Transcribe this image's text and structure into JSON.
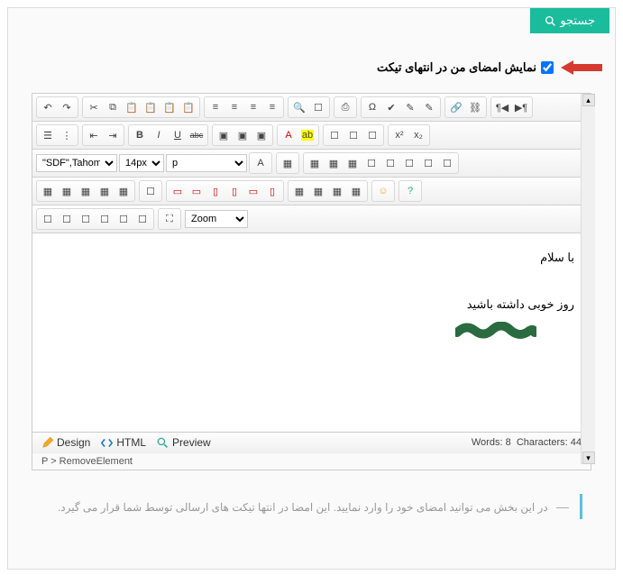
{
  "search": {
    "label": "جستجو"
  },
  "checkbox": {
    "label": "نمایش امضای من در انتهای تیکت",
    "checked": true
  },
  "toolbar": {
    "font_family": "\"SDF\",Tahom...",
    "font_size": "14px",
    "paragraph": "p",
    "zoom": "Zoom"
  },
  "content": {
    "line1": "با سلام",
    "line2": "روز خوبی داشته باشید"
  },
  "tabs": {
    "design": "Design",
    "html": "HTML",
    "preview": "Preview"
  },
  "status": {
    "words_label": "Words:",
    "words_val": "8",
    "chars_label": "Characters:",
    "chars_val": "44"
  },
  "path": "P > RemoveElement",
  "hint": "در این بخش می توانید امضای خود را وارد نمایید. این امضا در انتها تیکت های ارسالی توسط شما قرار می گیرد.",
  "icons": {
    "undo": "↶",
    "redo": "↷",
    "cut": "✂",
    "copy": "⧉",
    "paste": "📋",
    "bold": "B",
    "italic": "I",
    "underline": "U",
    "strike": "abc",
    "alignL": "≡",
    "alignC": "≡",
    "alignR": "≡",
    "alignJ": "≡",
    "list1": "☰",
    "list2": "⋮",
    "indent": "⇥",
    "outdent": "⇤",
    "link": "🔗",
    "unlink": "⛓",
    "image": "▦",
    "table": "▦",
    "omega": "Ω",
    "check": "✔",
    "brush": "✎",
    "color": "A",
    "bg": "ab",
    "find": "🔍",
    "replace": "⇄",
    "print": "⎙",
    "new": "☐",
    "folder": "▣",
    "sup": "x²",
    "sub": "x₂",
    "ltr": "¶◀",
    "rtl": "▶¶",
    "smile": "☺",
    "help": "?"
  }
}
